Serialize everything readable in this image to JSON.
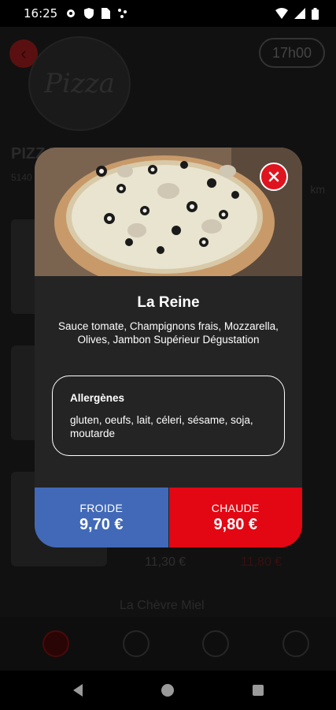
{
  "status_bar": {
    "time": "16:25",
    "left_icons": [
      "gear-icon",
      "shield-icon",
      "sim-icon",
      "dots-icon"
    ],
    "right_icons": [
      "wifi-icon",
      "signal-icon",
      "battery-icon"
    ]
  },
  "background": {
    "logo_text": "Pizza",
    "pickup_time": "17h00",
    "title_partial": "PIZZA",
    "subtitle_partial": "5140",
    "distance_partial": "km",
    "price_froide": "11,30 €",
    "price_chaude": "11,80 €",
    "next_item": "La Chèvre Miel"
  },
  "modal": {
    "title": "La Reine",
    "description": "Sauce tomate, Champignons frais, Mozzarella, Olives, Jambon Supérieur Dégustation",
    "allergens_title": "Allergènes",
    "allergens_list": "gluten, oeufs, lait, céleri, sésame, soja, moutarde",
    "froide_label": "FROIDE",
    "froide_price": "9,70 €",
    "chaude_label": "CHAUDE",
    "chaude_price": "9,80 €"
  },
  "colors": {
    "froide": "#4169b8",
    "chaude": "#e30613",
    "modal_bg": "#242424",
    "close": "#e0141e"
  }
}
